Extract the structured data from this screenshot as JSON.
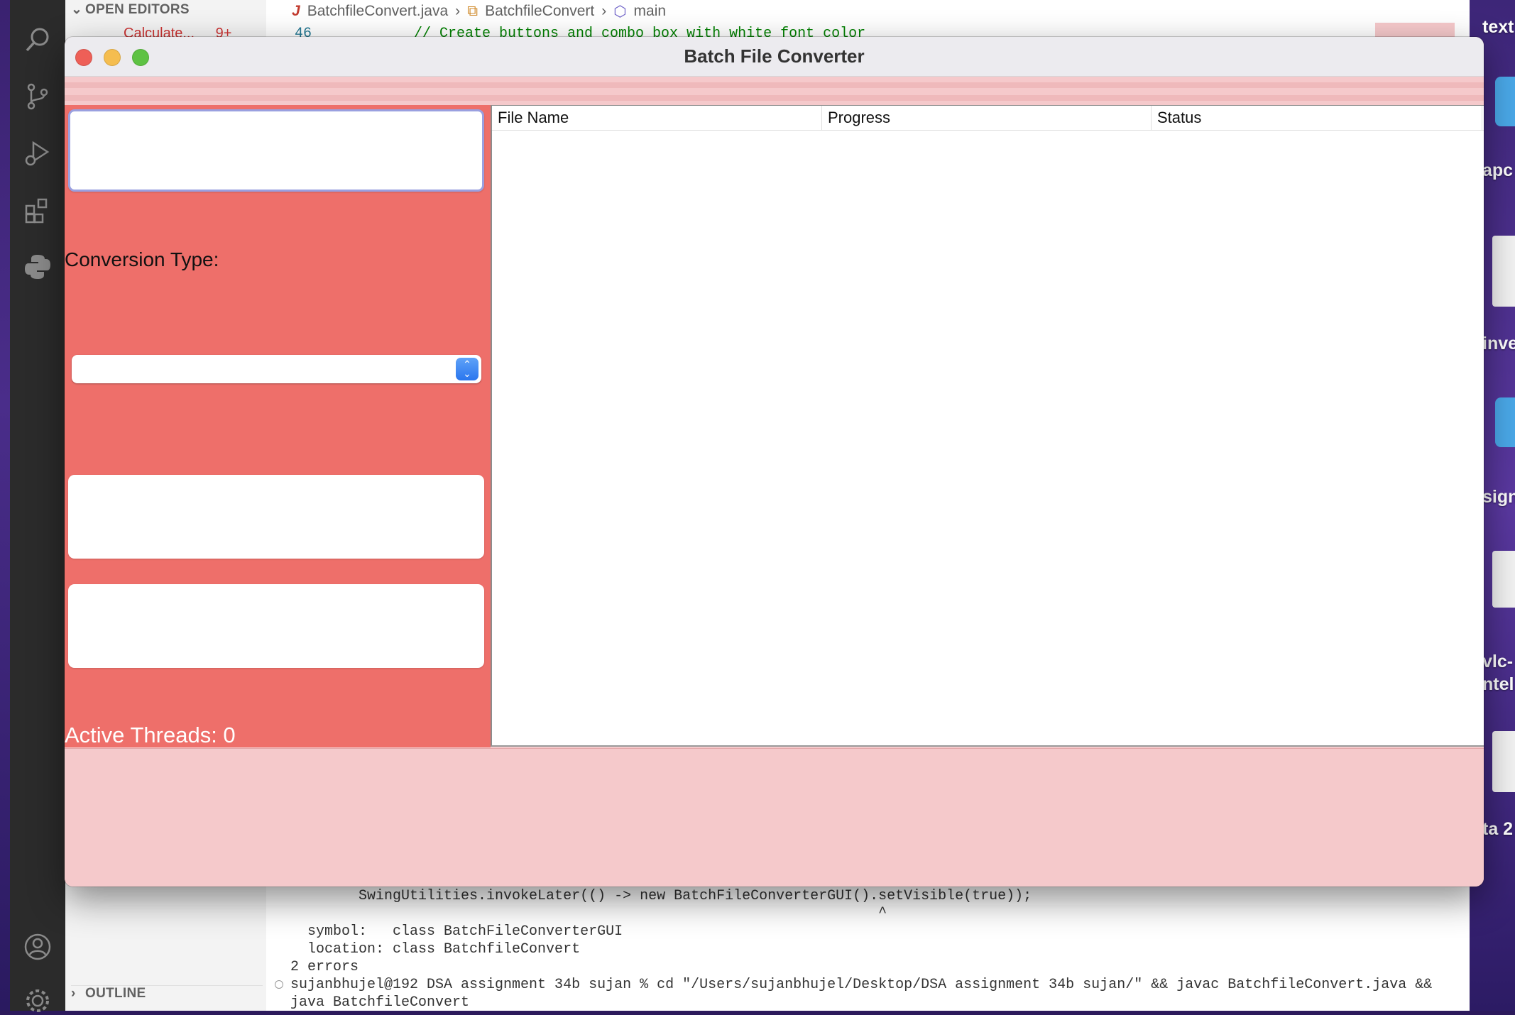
{
  "vscode": {
    "sidebar": {
      "open_editors_label": "OPEN EDITORS",
      "open_editor_file": "Calculate...",
      "open_editor_badge": "9+",
      "outline_label": "OUTLINE"
    },
    "breadcrumb": {
      "file": "BatchfileConvert.java",
      "class": "BatchfileConvert",
      "method": "main"
    },
    "editor": {
      "line_number": "46",
      "code_line": "// Create buttons and combo box with white font color"
    },
    "terminal": {
      "lines": [
        "        SwingUtilities.invokeLater(() -> new BatchFileConverterGUI().setVisible(true));",
        "                                                                     ^",
        "  symbol:   class BatchFileConverterGUI",
        "  location: class BatchfileConvert",
        "2 errors",
        "sujanbhujel@192 DSA assignment 34b sujan % cd \"/Users/sujanbhujel/Desktop/DSA assignment 34b sujan/\" && javac BatchfileConvert.java &&",
        "java BatchfileConvert"
      ]
    }
  },
  "desktop": {
    "labels": [
      "text",
      "apc",
      "inve",
      "sign",
      "vlc-",
      "ntel",
      "ta 2"
    ]
  },
  "app": {
    "window_title": "Batch File Converter",
    "conversion_type_label": "Conversion Type:",
    "conversion_selected": "",
    "active_threads_label": "Active Threads: 0",
    "table": {
      "columns": [
        "File Name",
        "Progress",
        "Status"
      ],
      "rows": []
    }
  },
  "colors": {
    "left_panel": "#ee6f6a",
    "window_bg": "#f5c9cb",
    "traffic_close": "#ee5f57",
    "traffic_min": "#f5bd4f",
    "traffic_max": "#5ec243",
    "stepper": "#2f7bf0"
  }
}
